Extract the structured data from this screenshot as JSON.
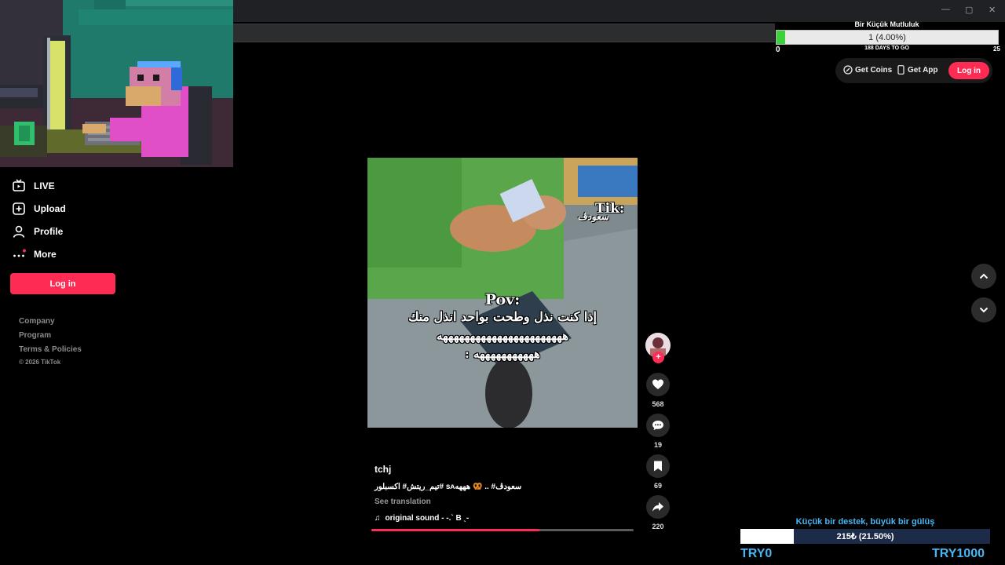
{
  "window": {
    "controls": [
      "—",
      "▢",
      "✕"
    ]
  },
  "goal": {
    "title": "Bir Küçük Mutluluk",
    "bar_text": "1 (4.00%)",
    "progress": 0.04,
    "min": "0",
    "max": "25",
    "days_left": "188 DAYS TO GO",
    "fill_color": "#3ad13a"
  },
  "sidebar": {
    "items": [
      {
        "label": "LIVE",
        "icon": "live-tv-icon"
      },
      {
        "label": "Upload",
        "icon": "plus-square-icon"
      },
      {
        "label": "Profile",
        "icon": "person-icon"
      },
      {
        "label": "More",
        "icon": "more-dots-icon"
      }
    ],
    "login_label": "Log in",
    "footer": {
      "company": "Company",
      "program": "Program",
      "terms": "Terms & Policies",
      "copyright": "© 2026 TikTok"
    }
  },
  "top_actions": {
    "get_coins": "Get Coins",
    "get_app": "Get App",
    "login": "Log in"
  },
  "video": {
    "watermark": "Tik:",
    "watermark_user": "سعودڤ",
    "overlay_pov": "Pov:",
    "overlay_line1": "إذا كنت نذل وطحت بواحد انذل منك",
    "overlay_line2": "هههههههههههههههههههههههه",
    "overlay_line3": "هههههههههههه :"
  },
  "rail": {
    "likes": "568",
    "comments": "19",
    "saves": "69",
    "shares": "220"
  },
  "post": {
    "author": "tchj",
    "caption": "تيم_ريتش# اكسبلور# ѕᴀسعودڤ# .. 🥨 هههه",
    "see_translation": "See translation",
    "sound": "original sound - -.` B ˎ-",
    "progress": 0.64
  },
  "donation": {
    "title": "Küçük bir destek, büyük bir gülüş",
    "bar_text": "215₺ (21.50%)",
    "progress": 0.215,
    "min": "TRY0",
    "max": "TRY1000"
  },
  "colors": {
    "accent": "#fe2c55",
    "donation_blue": "#47b6f2"
  }
}
